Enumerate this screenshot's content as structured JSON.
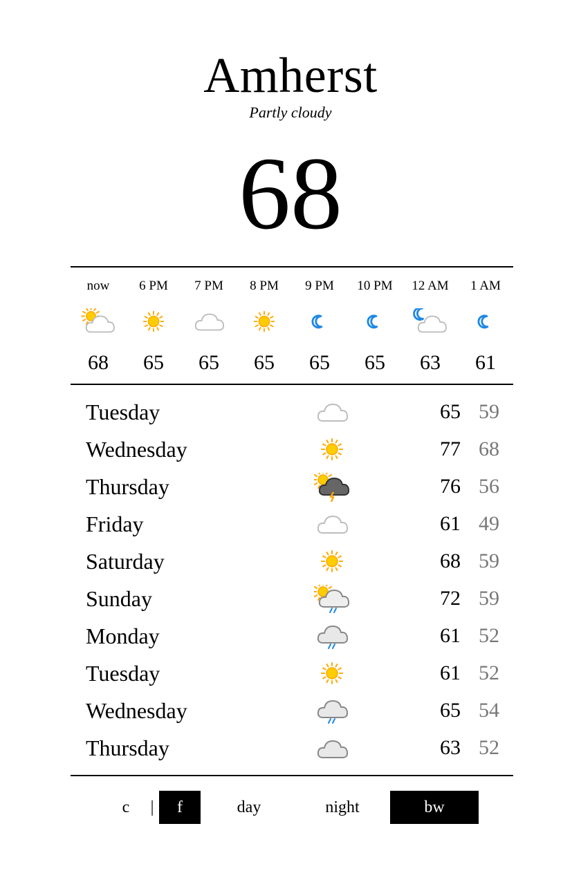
{
  "location": "Amherst",
  "condition": "Partly cloudy",
  "current_temp": "68",
  "hourly": [
    {
      "time": "now",
      "icon": "partly-cloudy-day-icon",
      "temp": "68"
    },
    {
      "time": "6 PM",
      "icon": "sun-icon",
      "temp": "65"
    },
    {
      "time": "7 PM",
      "icon": "cloud-icon",
      "temp": "65"
    },
    {
      "time": "8 PM",
      "icon": "sun-icon",
      "temp": "65"
    },
    {
      "time": "9 PM",
      "icon": "moon-icon",
      "temp": "65"
    },
    {
      "time": "10 PM",
      "icon": "moon-icon",
      "temp": "65"
    },
    {
      "time": "12 AM",
      "icon": "partly-cloudy-night-icon",
      "temp": "63"
    },
    {
      "time": "1 AM",
      "icon": "moon-icon",
      "temp": "61"
    }
  ],
  "daily": [
    {
      "day": "Tuesday",
      "icon": "cloud-icon",
      "high": "65",
      "low": "59"
    },
    {
      "day": "Wednesday",
      "icon": "sun-icon",
      "high": "77",
      "low": "68"
    },
    {
      "day": "Thursday",
      "icon": "thunderstorm-icon",
      "high": "76",
      "low": "56"
    },
    {
      "day": "Friday",
      "icon": "cloud-icon",
      "high": "61",
      "low": "49"
    },
    {
      "day": "Saturday",
      "icon": "sun-icon",
      "high": "68",
      "low": "59"
    },
    {
      "day": "Sunday",
      "icon": "sun-rain-icon",
      "high": "72",
      "low": "59"
    },
    {
      "day": "Monday",
      "icon": "rain-icon",
      "high": "61",
      "low": "52"
    },
    {
      "day": "Tuesday",
      "icon": "sun-icon",
      "high": "61",
      "low": "52"
    },
    {
      "day": "Wednesday",
      "icon": "rain-icon",
      "high": "65",
      "low": "54"
    },
    {
      "day": "Thursday",
      "icon": "overcast-icon",
      "high": "63",
      "low": "52"
    }
  ],
  "controls": {
    "celsius": "c",
    "separator": "|",
    "fahrenheit": "f",
    "day": "day",
    "night": "night",
    "bw": "bw",
    "active_unit": "f",
    "active_theme": "bw"
  },
  "colors": {
    "sun": "#FFCC00",
    "sun_ray": "#FFA800",
    "moon": "#1E88E5",
    "rain": "#1E88E5",
    "cloud_outline": "#BDBDBD",
    "storm_cloud": "#666666",
    "low_temp": "#777777"
  }
}
